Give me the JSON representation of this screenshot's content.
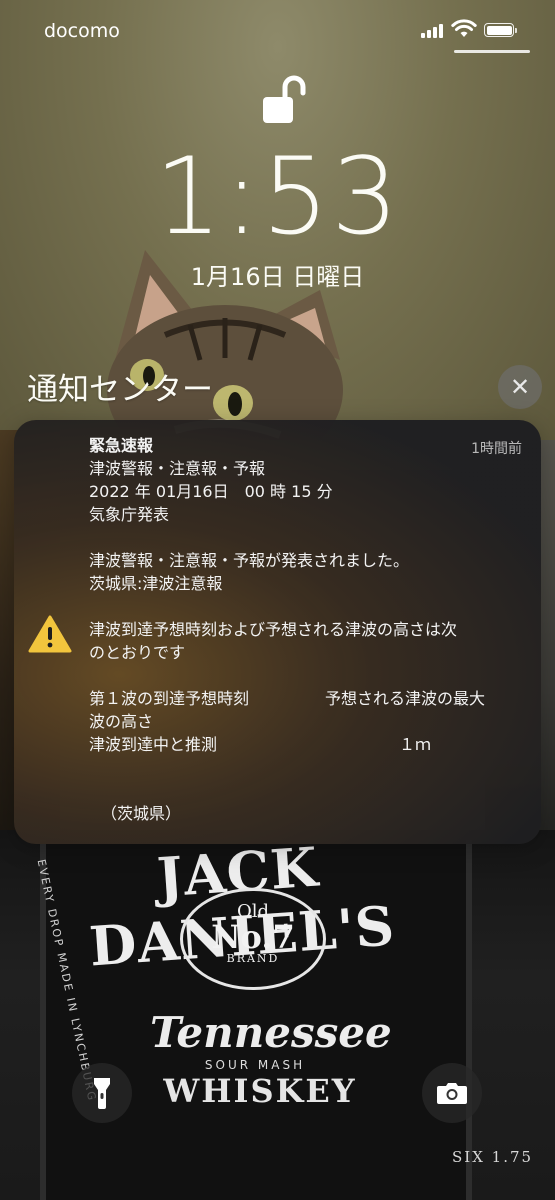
{
  "status_bar": {
    "carrier": "docomo",
    "signal_bars": 4,
    "battery_level": 1.0
  },
  "lock_screen": {
    "time": "1:53",
    "date": "1月16日 日曜日"
  },
  "notification_center": {
    "title": "通知センター"
  },
  "notification": {
    "icon": "warning-icon",
    "title": "緊急速報",
    "time_ago": "1時間前",
    "lines": [
      "津波警報・注意報・予報",
      "2022 年 01月16日　00 時 15 分",
      "気象庁発表",
      "津波警報・注意報・予報が発表されました。",
      "茨城県:津波注意報",
      "津波到達予想時刻および予想される津波の高さは次",
      "のとおりです"
    ],
    "table_header_left": "第１波の到達予想時刻",
    "table_header_right": "予想される津波の最大",
    "table_header_wrap": "波の高さ",
    "table_row_left": "津波到達中と推測",
    "table_row_right": "１ｍ",
    "footer": "（茨城県）"
  },
  "quick_actions": {
    "left": "flashlight-icon",
    "right": "camera-icon"
  },
  "wallpaper": {
    "brand": "JACK DANIEL'S",
    "badge_top": "Old",
    "badge_main": "No.7",
    "badge_sub": "BRAND",
    "name": "Tennessee",
    "sub": "SOUR MASH",
    "type": "WHISKEY",
    "side_text": "EVERY DROP MADE IN LYNCHBURG",
    "size": "SIX 1.75"
  },
  "colors": {
    "warning": "#f2c53d",
    "text": "#fbfbf5"
  }
}
